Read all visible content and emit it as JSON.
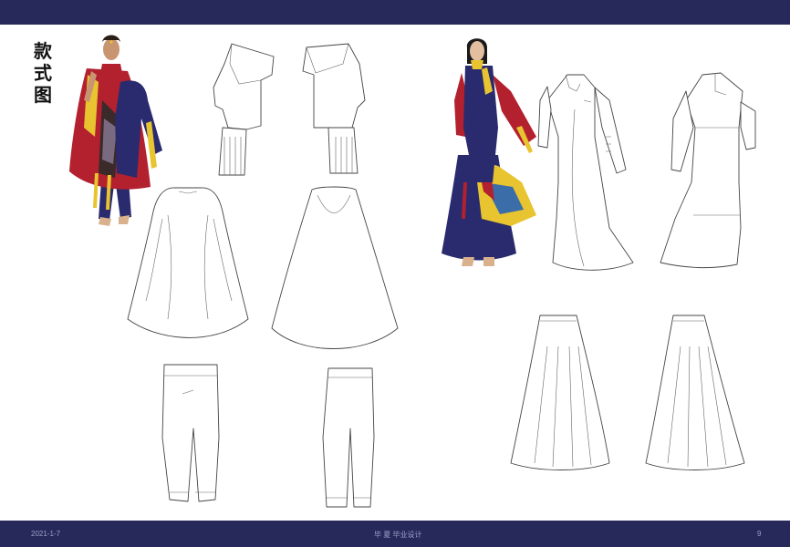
{
  "page": {
    "title_chars": [
      "款",
      "式",
      "图"
    ],
    "footer": {
      "date": "2021-1-7",
      "center": "毕 夏  毕业设计",
      "page_number": "9"
    }
  },
  "colors": {
    "header_bar": "#26295a",
    "garment_red": "#b3202e",
    "garment_navy": "#2a2b6e",
    "garment_yellow": "#e8c430"
  },
  "figures": [
    {
      "name": "male-model-illustration"
    },
    {
      "name": "female-model-illustration"
    }
  ]
}
